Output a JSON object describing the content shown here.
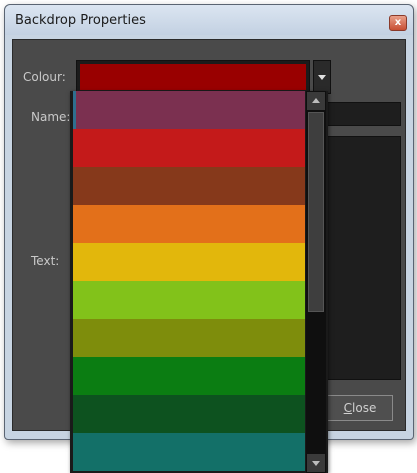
{
  "dialog": {
    "title": "Backdrop Properties",
    "close_glyph": "x",
    "close_button_label": "Close"
  },
  "fields": {
    "colour_label": "Colour:",
    "name_label": "Name:",
    "text_label": "Text:",
    "name_value": "",
    "text_value": ""
  },
  "colour": {
    "selected": "#990000",
    "options": [
      "#7b3050",
      "#c41a1a",
      "#86391b",
      "#e3701a",
      "#e2b70c",
      "#82c21a",
      "#7e8d0c",
      "#0b7d12",
      "#0d521f",
      "#137068"
    ]
  },
  "icons": {
    "title_close": "close-icon",
    "combo_arrow": "chevron-down-icon",
    "scroll_up": "arrow-up-icon",
    "scroll_down": "arrow-down-icon"
  }
}
